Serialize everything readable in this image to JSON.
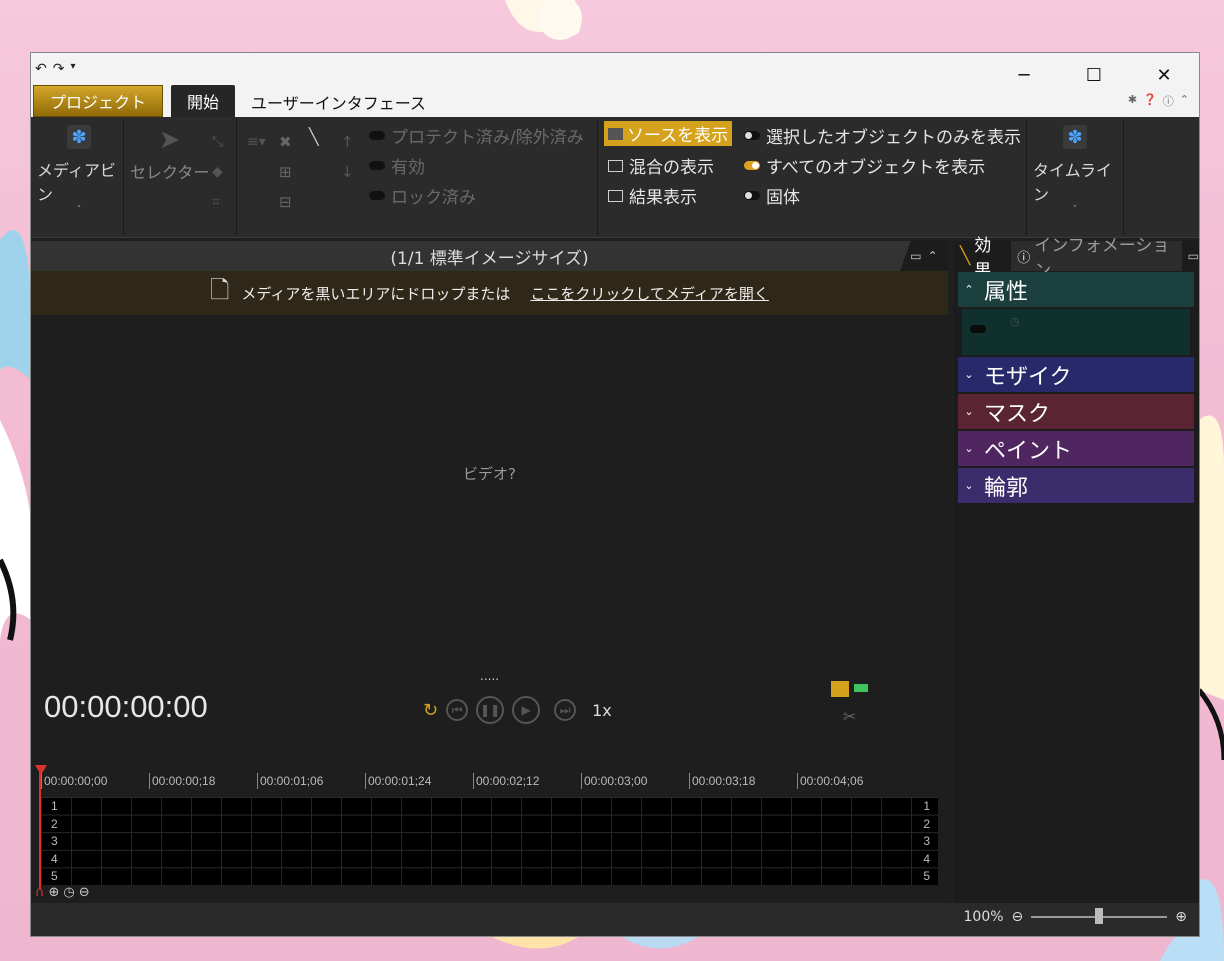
{
  "colors": {
    "accent": "#d4a21c",
    "section_attr": "#1a3f3c",
    "section_mosaic": "#27296a",
    "section_mask": "#5a2433",
    "section_paint": "#4f2660",
    "section_outline": "#3b2c6b"
  },
  "qat": {
    "undo_icon": "undo-icon",
    "redo_icon": "redo-icon",
    "menu_icon": "dropdown-icon"
  },
  "tabs": {
    "project": "プロジェクト",
    "start": "開始",
    "ui": "ユーザーインタフェース"
  },
  "ribbon": {
    "media_bin": "メディアビン",
    "selector": "セレクター",
    "protected": "プロテクト済み/除外済み",
    "enabled": "有効",
    "locked": "ロック済み",
    "show_source": "ソースを表示",
    "show_composite": "混合の表示",
    "show_result": "結果表示",
    "selected_only": "選択したオブジェクトのみを表示",
    "all_objects": "すべてのオブジェクトを表示",
    "solid": "固体",
    "timeline": "タイムライン"
  },
  "viewer": {
    "header": "(1/1  標準イメージサイズ)",
    "drop_text": "メディアを黒いエリアにドロップまたは",
    "drop_link": "ここをクリックしてメディアを開く",
    "video_label": "ビデオ?",
    "dots": ".....",
    "timecode": "00:00:00:00",
    "speed": "1x"
  },
  "timeline": {
    "ticks": [
      "00:00:00;00",
      "00:00:00;18",
      "00:00:01;06",
      "00:00:01;24",
      "00:00:02;12",
      "00:00:03;00",
      "00:00:03;18",
      "00:00:04;06"
    ],
    "tracks": [
      "1",
      "2",
      "3",
      "4",
      "5"
    ]
  },
  "panel": {
    "tab_effects": "効果",
    "tab_info": "インフォメーション",
    "sections": [
      "属性",
      "モザイク",
      "マスク",
      "ペイント",
      "輪郭"
    ]
  },
  "status": {
    "zoom": "100%",
    "zoom_level_fraction": 0.5
  }
}
